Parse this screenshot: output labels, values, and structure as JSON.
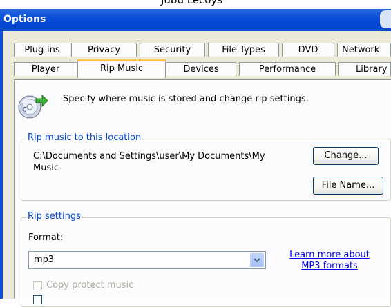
{
  "top_strip_text": "Jubu Lecoys",
  "window": {
    "title": "Options"
  },
  "tabs_row1": [
    {
      "label": "Plug-ins"
    },
    {
      "label": "Privacy"
    },
    {
      "label": "Security"
    },
    {
      "label": "File Types"
    },
    {
      "label": "DVD"
    },
    {
      "label": "Network"
    }
  ],
  "tabs_row2": [
    {
      "label": "Player"
    },
    {
      "label": "Rip Music",
      "selected": true
    },
    {
      "label": "Devices"
    },
    {
      "label": "Performance"
    },
    {
      "label": "Library"
    }
  ],
  "header": {
    "icon": "cd-rip-icon",
    "description": "Specify where music is stored and change rip settings."
  },
  "location": {
    "legend": "Rip music to this location",
    "path_line1": "C:\\Documents and Settings\\user\\My Documents\\My",
    "path_line2": "Music",
    "change_button": "Change...",
    "filename_button": "File Name..."
  },
  "rip_settings": {
    "legend": "Rip settings",
    "format_label": "Format:",
    "format_value": "mp3",
    "learn_line1": "Learn more about",
    "learn_line2": "MP3 formats",
    "copy_protect_label": "Copy protect music"
  },
  "colors": {
    "titlebar": "#0a4cd6",
    "tab_highlight": "#ffc83c",
    "legend_text": "#0046d5",
    "link": "#0000ff",
    "disabled_text": "#aca899"
  }
}
